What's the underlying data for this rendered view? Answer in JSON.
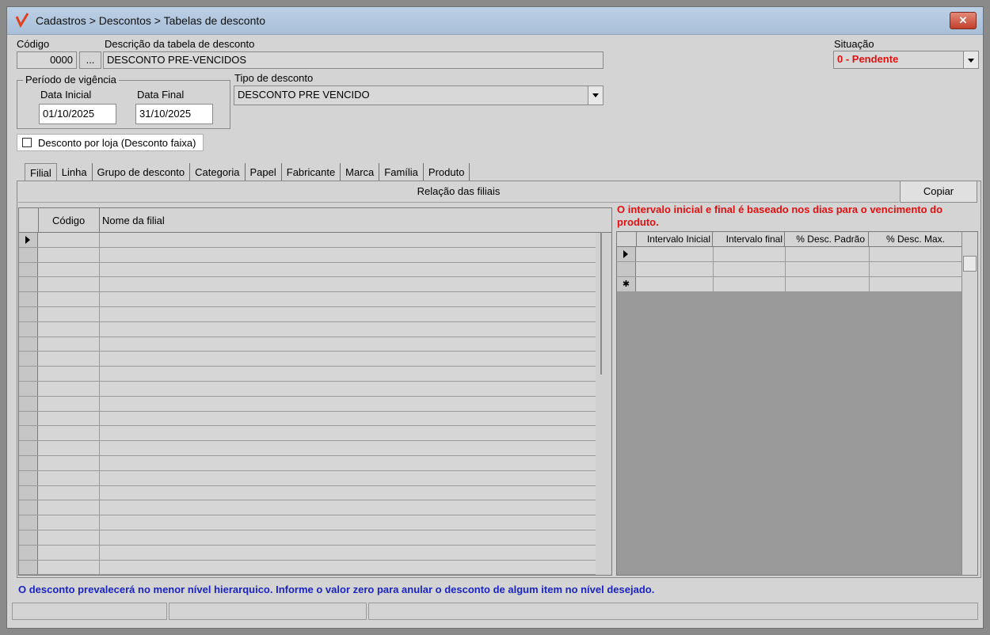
{
  "window": {
    "title": "Cadastros > Descontos > Tabelas de desconto",
    "close_label": "✕"
  },
  "form": {
    "codigo_label": "Código",
    "codigo_value": "0000",
    "lookup_label": "...",
    "descricao_label": "Descrição da tabela de desconto",
    "descricao_value": "DESCONTO PRE-VENCIDOS",
    "situacao_label": "Situação",
    "situacao_value": "0 - Pendente",
    "periodo_label": "Período de vigência",
    "data_inicial_label": "Data Inicial",
    "data_inicial_value": "01/10/2025",
    "data_final_label": "Data Final",
    "data_final_value": "31/10/2025",
    "tipo_label": "Tipo de desconto",
    "tipo_value": "DESCONTO PRE VENCIDO",
    "checkbox_label": "Desconto por loja (Desconto faixa)",
    "checkbox_checked": false
  },
  "tabs": [
    "Filial",
    "Linha",
    "Grupo de desconto",
    "Categoria",
    "Papel",
    "Fabricante",
    "Marca",
    "Família",
    "Produto"
  ],
  "filiais": {
    "header": "Relação das filiais",
    "copy_button": "Copiar",
    "columns": [
      "Código",
      "Nome da filial"
    ]
  },
  "intervals": {
    "note": "O intervalo inicial e final é baseado nos dias para o vencimento do produto.",
    "columns": [
      "Intervalo Inicial",
      "Intervalo final",
      "% Desc. Padrão",
      "% Desc. Max."
    ],
    "new_row_marker": "✱"
  },
  "footer_note": "O desconto prevalecerá no menor nível hierarquico. Informe o valor zero para anular o desconto de algum item no nível desejado.",
  "colors": {
    "accent_red": "#e01010",
    "note_blue": "#1a24c0"
  }
}
